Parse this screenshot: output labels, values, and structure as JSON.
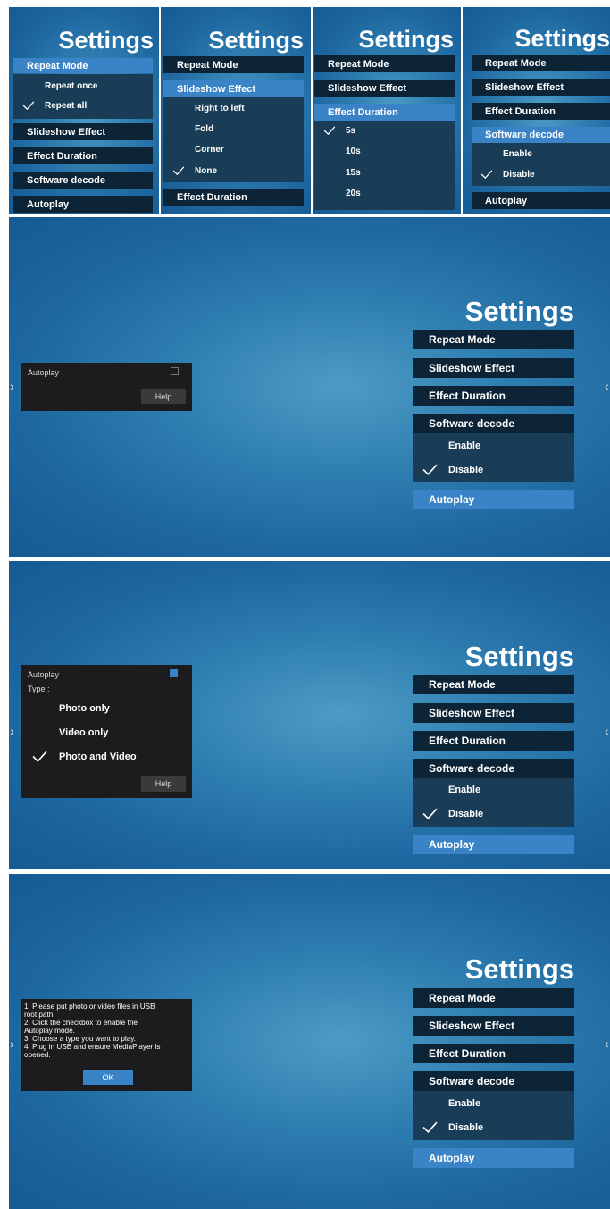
{
  "strip": [
    {
      "title": "Settings",
      "items": [
        {
          "label": "Repeat Mode",
          "active": true
        },
        {
          "label": "Slideshow Effect"
        },
        {
          "label": "Effect Duration"
        },
        {
          "label": "Software decode"
        },
        {
          "label": "Autoplay"
        }
      ],
      "submenu": {
        "under": "Repeat Mode",
        "options": [
          "Repeat once",
          "Repeat all"
        ],
        "checked": "Repeat all"
      }
    },
    {
      "title": "Settings",
      "items": [
        {
          "label": "Repeat Mode"
        },
        {
          "label": "Slideshow Effect",
          "active": true
        },
        {
          "label": "Effect Duration"
        }
      ],
      "submenu": {
        "under": "Slideshow Effect",
        "options": [
          "Right to left",
          "Fold",
          "Corner",
          "None"
        ],
        "checked": "None"
      }
    },
    {
      "title": "Settings",
      "items": [
        {
          "label": "Repeat Mode"
        },
        {
          "label": "Slideshow Effect"
        },
        {
          "label": "Effect Duration",
          "active": true
        }
      ],
      "submenu": {
        "under": "Effect Duration",
        "options": [
          "5s",
          "10s",
          "15s",
          "20s"
        ],
        "checked": "5s"
      }
    },
    {
      "title": "Settings",
      "items": [
        {
          "label": "Repeat Mode"
        },
        {
          "label": "Slideshow Effect"
        },
        {
          "label": "Effect Duration"
        },
        {
          "label": "Software decode",
          "active": true
        },
        {
          "label": "Autoplay"
        }
      ],
      "submenu": {
        "under": "Software decode",
        "options": [
          "Enable",
          "Disable"
        ],
        "checked": "Disable"
      }
    }
  ],
  "panels": [
    {
      "title": "Settings",
      "items": [
        "Repeat Mode",
        "Slideshow Effect",
        "Effect Duration",
        "Software decode",
        "Autoplay"
      ],
      "decode_options": [
        "Enable",
        "Disable"
      ],
      "decode_checked": "Disable",
      "popup": {
        "autoplay_label": "Autoplay",
        "checkbox_checked": false,
        "help_label": "Help"
      }
    },
    {
      "title": "Settings",
      "items": [
        "Repeat Mode",
        "Slideshow Effect",
        "Effect Duration",
        "Software decode",
        "Autoplay"
      ],
      "decode_options": [
        "Enable",
        "Disable"
      ],
      "decode_checked": "Disable",
      "popup": {
        "autoplay_label": "Autoplay",
        "checkbox_checked": true,
        "type_label": "Type :",
        "types": [
          "Photo only",
          "Video only",
          "Photo and Video"
        ],
        "type_checked": "Photo and Video",
        "help_label": "Help"
      }
    },
    {
      "title": "Settings",
      "items": [
        "Repeat Mode",
        "Slideshow Effect",
        "Effect Duration",
        "Software decode",
        "Autoplay"
      ],
      "decode_options": [
        "Enable",
        "Disable"
      ],
      "decode_checked": "Disable",
      "help": {
        "lines": [
          "1. Please put photo or video files in USB",
          "root path.",
          "2. Click the checkbox to enable the",
          "Autoplay mode.",
          "3. Choose a type you want to play.",
          "4. Plug in USB and ensure MediaPlayer is",
          "opened."
        ],
        "ok_label": "OK"
      }
    }
  ],
  "nav": {
    "left_arrow": "›",
    "right_arrow": "‹"
  },
  "colors": {
    "menu_item": "#0d2436",
    "active": "#3b83c7",
    "submenu": "#1a3d57",
    "popup": "#1c1c1e"
  }
}
